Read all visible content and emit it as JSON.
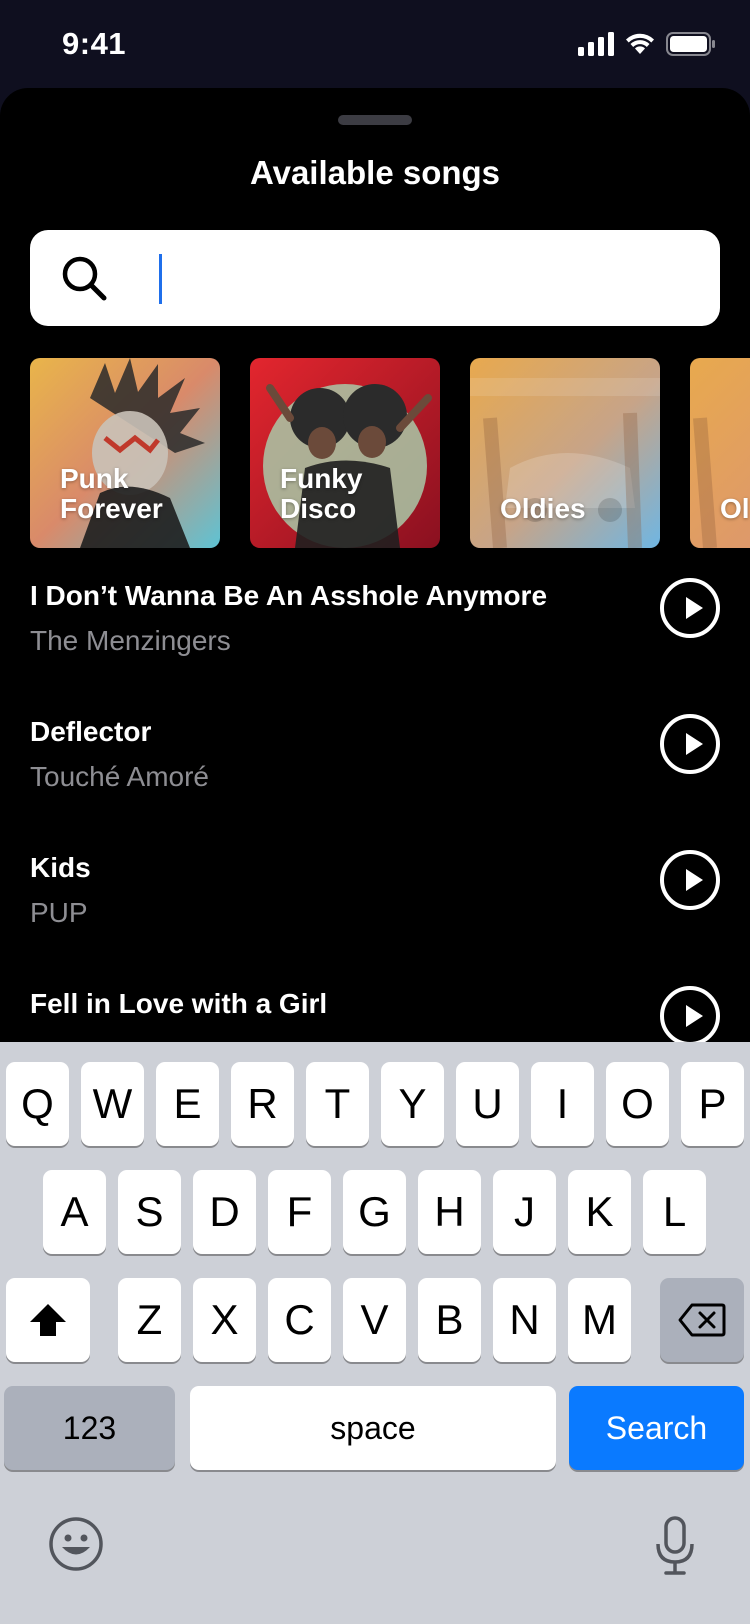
{
  "status_bar": {
    "time": "9:41"
  },
  "sheet": {
    "title": "Available songs",
    "search": {
      "value": "",
      "placeholder": ""
    }
  },
  "playlists": [
    {
      "label_line1": "Punk",
      "label_line2": "Forever"
    },
    {
      "label_line1": "Funky",
      "label_line2": "Disco"
    },
    {
      "label_line1": "",
      "label_line2": "Oldies"
    },
    {
      "label_line1": "",
      "label_line2": "Ol"
    }
  ],
  "songs": [
    {
      "title": "I Don’t Wanna Be An Asshole Anymore",
      "artist": "The Menzingers"
    },
    {
      "title": "Deflector",
      "artist": "Touché Amoré"
    },
    {
      "title": "Kids",
      "artist": "PUP"
    },
    {
      "title": "Fell in Love with a Girl",
      "artist": ""
    }
  ],
  "keyboard": {
    "row1": [
      "Q",
      "W",
      "E",
      "R",
      "T",
      "Y",
      "U",
      "I",
      "O",
      "P"
    ],
    "row2": [
      "A",
      "S",
      "D",
      "F",
      "G",
      "H",
      "J",
      "K",
      "L"
    ],
    "row3": [
      "Z",
      "X",
      "C",
      "V",
      "B",
      "N",
      "M"
    ],
    "numbers_label": "123",
    "space_label": "space",
    "return_label": "Search",
    "icons": [
      "shift-icon",
      "delete-icon",
      "emoji-icon",
      "microphone-icon"
    ]
  },
  "colors": {
    "accent": "#0a7aff",
    "sheet_bg": "#000000",
    "status_bg": "#0f0f1f",
    "keyboard_bg": "#cdd0d7",
    "secondary_text": "#8e8e93"
  }
}
